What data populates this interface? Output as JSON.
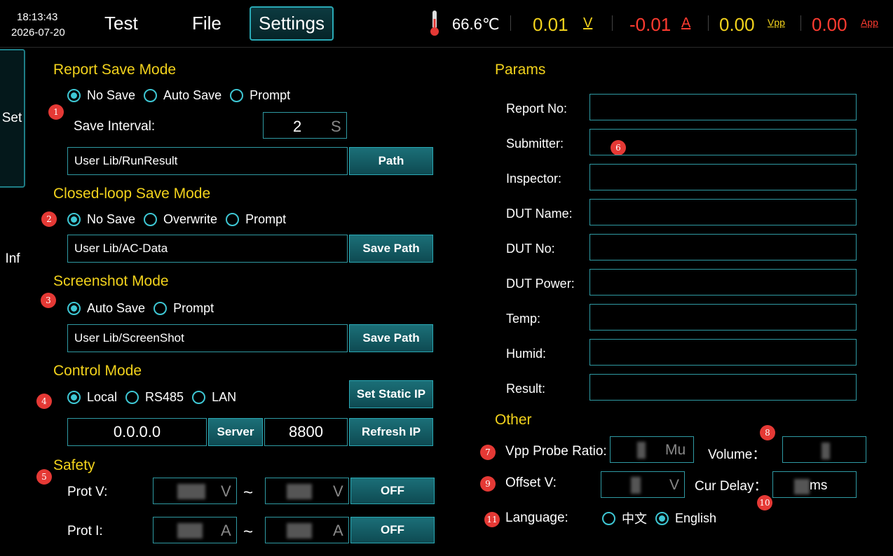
{
  "status": {
    "time": "18:13:43",
    "date": "2026-07-20"
  },
  "menu": {
    "test": "Test",
    "file": "File",
    "settings": "Settings"
  },
  "readings": {
    "temperature": "66.6℃",
    "voltage": "0.01",
    "voltage_unit": "V",
    "current": "-0.01",
    "current_unit": "A",
    "vpp": "0.00",
    "vpp_unit": "Vpp",
    "app": "0.00",
    "app_unit": "App"
  },
  "side_tabs": {
    "set": "Set",
    "inf": "Inf"
  },
  "report_save": {
    "title": "Report Save Mode",
    "options": [
      "No Save",
      "Auto Save",
      "Prompt"
    ],
    "selected": "No Save",
    "interval_label": "Save Interval:",
    "interval_value": "2",
    "interval_unit": "S",
    "path": "User Lib/RunResult",
    "path_button": "Path"
  },
  "closed_loop": {
    "title": "Closed-loop Save Mode",
    "options": [
      "No Save",
      "Overwrite",
      "Prompt"
    ],
    "selected": "No Save",
    "path": "User Lib/AC-Data",
    "path_button": "Save Path"
  },
  "screenshot": {
    "title": "Screenshot Mode",
    "options": [
      "Auto Save",
      "Prompt"
    ],
    "selected": "Auto Save",
    "path": "User Lib/ScreenShot",
    "path_button": "Save Path"
  },
  "control": {
    "title": "Control Mode",
    "options": [
      "Local",
      "RS485",
      "LAN"
    ],
    "selected": "Local",
    "static_ip_button": "Set Static IP",
    "ip": "0.0.0.0",
    "server_button": "Server",
    "port": "8800",
    "refresh_button": "Refresh IP"
  },
  "safety": {
    "title": "Safety",
    "prot_v_label": "Prot V:",
    "prot_v_unit": "V",
    "prot_v_button": "OFF",
    "prot_i_label": "Prot I:",
    "prot_i_unit": "A",
    "prot_i_button": "OFF",
    "range_sep": "~"
  },
  "params": {
    "title": "Params",
    "fields": [
      "Report No:",
      "Submitter:",
      "Inspector:",
      "DUT Name:",
      "DUT No:",
      "DUT Power:",
      "Temp:",
      "Humid:",
      "Result:"
    ]
  },
  "other": {
    "title": "Other",
    "vpp_probe_label": "Vpp Probe Ratio:",
    "vpp_probe_unit": "Mu",
    "volume_label": "Volume：",
    "offset_label": "Offset V:",
    "offset_unit": "V",
    "cur_delay_label": "Cur Delay：",
    "cur_delay_unit": "ms",
    "language_label": "Language:",
    "language_options": [
      "中文",
      "English"
    ],
    "language_selected": "English"
  },
  "badges": [
    "1",
    "2",
    "3",
    "4",
    "5",
    "6",
    "7",
    "8",
    "9",
    "10",
    "11"
  ],
  "colors": {
    "accent": "#3ec7d4",
    "title": "#f2d21c",
    "voltage": "#f2d21c",
    "current": "#ff3b30",
    "badge": "#e53935"
  }
}
